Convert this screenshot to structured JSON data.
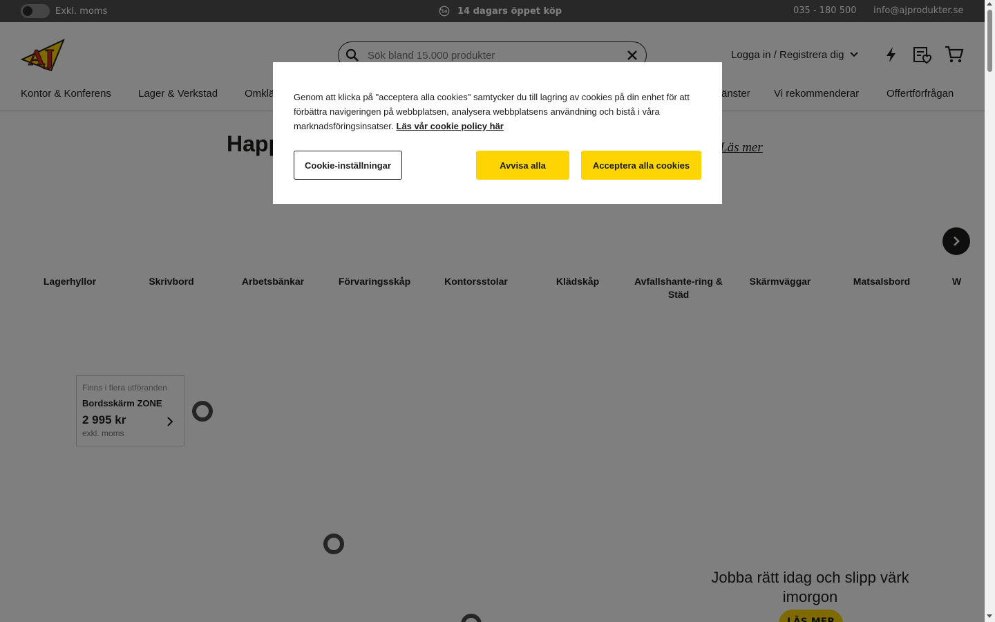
{
  "topbar": {
    "vat_label": "Exkl. moms",
    "promo_text": "14 dagars öppet köp",
    "phone": "035 - 180 500",
    "email": "info@ajprodukter.se"
  },
  "header": {
    "search_placeholder": "Sök bland 15.000 produkter",
    "login_label": "Logga in / Registrera dig"
  },
  "nav": {
    "items": [
      "Kontor & Konferens",
      "Lager & Verkstad",
      "Omklä",
      "änster",
      "Vi rekommenderar",
      "Offertförfrågan"
    ]
  },
  "hero": {
    "title_fragment": "Happ",
    "link_fragment": "Läs mer"
  },
  "categories": [
    "Lagerhyllor",
    "Skrivbord",
    "Arbetsbänkar",
    "Förvaringsskåp",
    "Kontorsstolar",
    "Klädskåp",
    "Avfallshante-ring & Städ",
    "Skärmväggar",
    "Matsalsbord",
    "W"
  ],
  "product_card": {
    "variant_note": "Finns i flera utföranden",
    "name": "Bordsskärm ZONE",
    "price": "2 995 kr",
    "vat_note": "exkl. moms"
  },
  "promo_block": {
    "heading": "Jobba rätt idag och slipp värk imorgon",
    "button": "LÄS MER"
  },
  "cookie": {
    "text": "Genom att klicka på \"acceptera alla cookies\" samtycker du till lagring av cookies på din enhet för att förbättra navigeringen på webbplatsen, analysera webbplatsens användning och bistå i våra marknadsföringsinsatser.",
    "policy_link": "Läs vår cookie policy här",
    "settings_button": "Cookie-inställningar",
    "reject_button": "Avvisa alla",
    "accept_button": "Acceptera alla cookies"
  },
  "colors": {
    "brand_yellow": "#ffd500",
    "topbar": "#505050",
    "logo_red": "#d9281f"
  },
  "icons": [
    "search-icon",
    "clear-icon",
    "chevron-down-icon",
    "lightning-icon",
    "wishlist-icon",
    "cart-icon",
    "chevron-right-icon",
    "return-icon"
  ]
}
